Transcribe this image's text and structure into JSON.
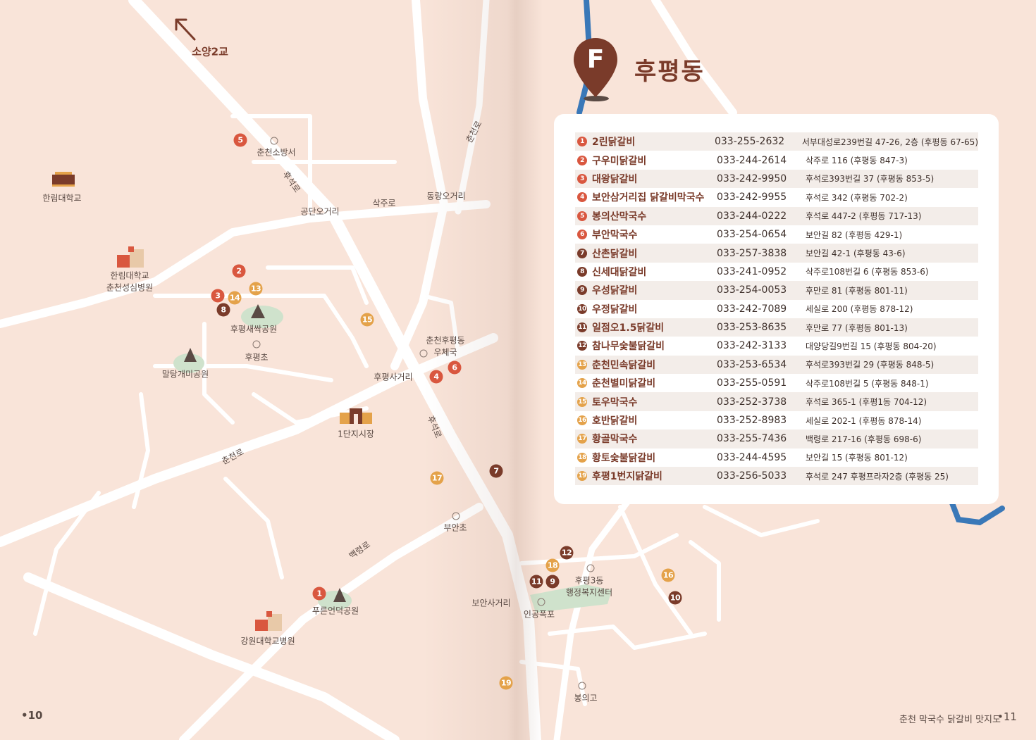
{
  "header": {
    "marker_letter": "F",
    "district": "후평동"
  },
  "page": {
    "left_number": "10",
    "right_number": "11",
    "footer_title": "춘천 막국수 닭갈비 맛지도"
  },
  "colors": {
    "red": "#d9573f",
    "dark": "#7a3b2a",
    "orange": "#e4a24a",
    "river": "#3a78b8",
    "park": "#cfe2cc"
  },
  "labels": {
    "soyang": "소양2교",
    "fire": "춘천소방서",
    "hallym": "한림대학교",
    "hallym_hospital_1": "한림대학교",
    "hallym_hospital_2": "춘천성심병원",
    "gongdan": "공단오거리",
    "sakjuro": "삭주로",
    "dongnae": "동랑오거리",
    "chuncheonro_top": "춘천로",
    "huseokro_top": "후석로",
    "saessak": "후평새싹공원",
    "hupyeong_school": "후평초",
    "maltang": "말탕개미공원",
    "post_1": "춘천후평동",
    "post_2": "우체국",
    "intersection": "후평사거리",
    "market": "1단지시장",
    "huseokro_mid": "후석로",
    "chuncheonro_left": "춘천로",
    "buan_school": "부안초",
    "baekryeongro": "백령로",
    "green_park": "푸른언덕공원",
    "kangwon_hospital": "강원대학교병원",
    "boan": "보안사거리",
    "waterfall": "인공폭포",
    "center_1": "후평3동",
    "center_2": "행정복지센터",
    "bongui": "봉의고"
  },
  "map_pins": [
    {
      "n": "1",
      "color": "red"
    },
    {
      "n": "2",
      "color": "red"
    },
    {
      "n": "3",
      "color": "red"
    },
    {
      "n": "4",
      "color": "red"
    },
    {
      "n": "5",
      "color": "red"
    },
    {
      "n": "6",
      "color": "red"
    },
    {
      "n": "7",
      "color": "dark"
    },
    {
      "n": "8",
      "color": "dark"
    },
    {
      "n": "9",
      "color": "dark"
    },
    {
      "n": "10",
      "color": "dark"
    },
    {
      "n": "11",
      "color": "dark"
    },
    {
      "n": "12",
      "color": "dark"
    },
    {
      "n": "13",
      "color": "orange"
    },
    {
      "n": "14",
      "color": "orange"
    },
    {
      "n": "15",
      "color": "orange"
    },
    {
      "n": "16",
      "color": "orange"
    },
    {
      "n": "17",
      "color": "orange"
    },
    {
      "n": "18",
      "color": "orange"
    },
    {
      "n": "19",
      "color": "orange"
    }
  ],
  "restaurants": [
    {
      "n": "1",
      "color": "red",
      "name": "2린닭갈비",
      "phone": "033-255-2632",
      "addr": "서부대성로239번길 47-26, 2층 (후평동 67-65)"
    },
    {
      "n": "2",
      "color": "red",
      "name": "구우미닭갈비",
      "phone": "033-244-2614",
      "addr": "삭주로 116 (후평동 847-3)"
    },
    {
      "n": "3",
      "color": "red",
      "name": "대왕닭갈비",
      "phone": "033-242-9950",
      "addr": "후석로393번길 37 (후평동 853-5)"
    },
    {
      "n": "4",
      "color": "red",
      "name": "보안삼거리집 닭갈비막국수",
      "phone": "033-242-9955",
      "addr": "후석로 342 (후평동 702-2)"
    },
    {
      "n": "5",
      "color": "red",
      "name": "봉의산막국수",
      "phone": "033-244-0222",
      "addr": "후석로 447-2 (후평동 717-13)"
    },
    {
      "n": "6",
      "color": "red",
      "name": "부안막국수",
      "phone": "033-254-0654",
      "addr": "보안길 82 (후평동 429-1)"
    },
    {
      "n": "7",
      "color": "dark",
      "name": "산촌닭갈비",
      "phone": "033-257-3838",
      "addr": "보안길 42-1 (후평동 43-6)"
    },
    {
      "n": "8",
      "color": "dark",
      "name": "신세대닭갈비",
      "phone": "033-241-0952",
      "addr": "삭주로108번길 6 (후평동 853-6)"
    },
    {
      "n": "9",
      "color": "dark",
      "name": "우성닭갈비",
      "phone": "033-254-0053",
      "addr": "후만로 81 (후평동 801-11)"
    },
    {
      "n": "10",
      "color": "dark",
      "name": "우정닭갈비",
      "phone": "033-242-7089",
      "addr": "세실로 200 (후평동 878-12)"
    },
    {
      "n": "11",
      "color": "dark",
      "name": "일점오1.5닭갈비",
      "phone": "033-253-8635",
      "addr": "후만로 77 (후평동 801-13)"
    },
    {
      "n": "12",
      "color": "dark",
      "name": "참나무숯불닭갈비",
      "phone": "033-242-3133",
      "addr": "대양당길9번길 15 (후평동 804-20)"
    },
    {
      "n": "13",
      "color": "orange",
      "name": "춘천민속닭갈비",
      "phone": "033-253-6534",
      "addr": "후석로393번길 29 (후평동 848-5)"
    },
    {
      "n": "14",
      "color": "orange",
      "name": "춘천별미닭갈비",
      "phone": "033-255-0591",
      "addr": "삭주로108번길 5 (후평동 848-1)"
    },
    {
      "n": "15",
      "color": "orange",
      "name": "토우막국수",
      "phone": "033-252-3738",
      "addr": "후석로 365-1 (후평1동 704-12)"
    },
    {
      "n": "16",
      "color": "orange",
      "name": "호반닭갈비",
      "phone": "033-252-8983",
      "addr": "세실로 202-1 (후평동 878-14)"
    },
    {
      "n": "17",
      "color": "orange",
      "name": "황골막국수",
      "phone": "033-255-7436",
      "addr": "백령로 217-16 (후평동 698-6)"
    },
    {
      "n": "18",
      "color": "orange",
      "name": "황토숯불닭갈비",
      "phone": "033-244-4595",
      "addr": "보안길 15 (후평동 801-12)"
    },
    {
      "n": "19",
      "color": "orange",
      "name": "후평1번지닭갈비",
      "phone": "033-256-5033",
      "addr": "후석로 247 후평프라자2층 (후평동 25)"
    }
  ]
}
